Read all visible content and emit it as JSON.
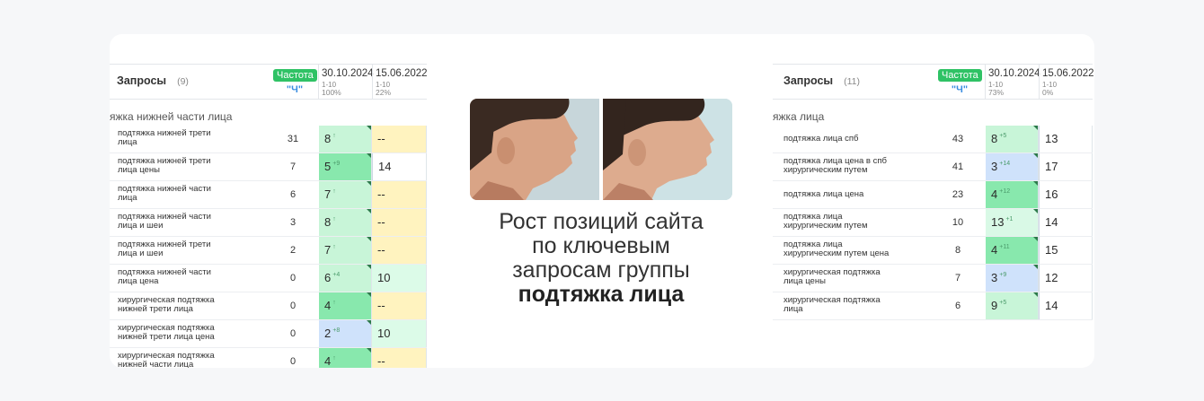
{
  "headline": {
    "line1": "Рост позиций сайта",
    "line2": "по ключевым",
    "line3": "запросам группы",
    "line4": "подтяжка лица"
  },
  "photos": {
    "left_icon": "face-profile-before-icon",
    "right_icon": "face-profile-after-icon"
  },
  "left_table": {
    "header": {
      "title": "Запросы",
      "count": "(9)",
      "freq_label": "Частота",
      "freq_sub": "\"Ч\""
    },
    "dates": [
      {
        "date": "30.10.2024",
        "range": "1-10",
        "pct": "100%"
      },
      {
        "date": "15.06.2022",
        "range": "1-10",
        "pct": "22%"
      }
    ],
    "group": "яжка нижней части лица",
    "rows": [
      {
        "q1": "подтяжка нижней трети",
        "q2": "лица",
        "freq": "31",
        "pos": "8",
        "delta": "↑",
        "old": "--"
      },
      {
        "q1": "подтяжка нижней трети",
        "q2": "лица цены",
        "freq": "7",
        "pos": "5",
        "delta": "+9",
        "old": "14"
      },
      {
        "q1": "подтяжка нижней части",
        "q2": "лица",
        "freq": "6",
        "pos": "7",
        "delta": "↑",
        "old": "--"
      },
      {
        "q1": "подтяжка нижней части",
        "q2": "лица и шеи",
        "freq": "3",
        "pos": "8",
        "delta": "↑",
        "old": "--"
      },
      {
        "q1": "подтяжка нижней трети",
        "q2": "лица и шеи",
        "freq": "2",
        "pos": "7",
        "delta": "↑",
        "old": "--"
      },
      {
        "q1": "подтяжка нижней части",
        "q2": "лица цена",
        "freq": "0",
        "pos": "6",
        "delta": "+4",
        "old": "10"
      },
      {
        "q1": "хирургическая подтяжка",
        "q2": "нижней трети лица",
        "freq": "0",
        "pos": "4",
        "delta": "↑",
        "old": "--"
      },
      {
        "q1": "хирургическая подтяжка",
        "q2": "нижней трети лица цена",
        "freq": "0",
        "pos": "2",
        "delta": "+8",
        "old": "10"
      },
      {
        "q1": "хирургическая подтяжка",
        "q2": "нижней части лица",
        "freq": "0",
        "pos": "4",
        "delta": "↑",
        "old": "--"
      }
    ]
  },
  "right_table": {
    "header": {
      "title": "Запросы",
      "count": "(11)",
      "freq_label": "Частота",
      "freq_sub": "\"Ч\""
    },
    "dates": [
      {
        "date": "30.10.2024",
        "range": "1-10",
        "pct": "73%"
      },
      {
        "date": "15.06.2022",
        "range": "1-10",
        "pct": "0%"
      }
    ],
    "group": "яжка лица",
    "rows": [
      {
        "q1": "подтяжка лица спб",
        "q2": "",
        "freq": "43",
        "pos": "8",
        "delta": "+5",
        "old": "13"
      },
      {
        "q1": "подтяжка лица цена в спб",
        "q2": "хирургическим путем",
        "freq": "41",
        "pos": "3",
        "delta": "+14",
        "old": "17"
      },
      {
        "q1": "подтяжка лица цена",
        "q2": "",
        "freq": "23",
        "pos": "4",
        "delta": "+12",
        "old": "16"
      },
      {
        "q1": "подтяжка лица",
        "q2": "хирургическим путем",
        "freq": "10",
        "pos": "13",
        "delta": "+1",
        "old": "14"
      },
      {
        "q1": "подтяжка лица",
        "q2": "хирургическим путем цена",
        "freq": "8",
        "pos": "4",
        "delta": "+11",
        "old": "15"
      },
      {
        "q1": "хирургическая подтяжка",
        "q2": "лица цены",
        "freq": "7",
        "pos": "3",
        "delta": "+9",
        "old": "12"
      },
      {
        "q1": "хирургическая подтяжка",
        "q2": "лица",
        "freq": "6",
        "pos": "9",
        "delta": "+5",
        "old": "14"
      }
    ]
  }
}
